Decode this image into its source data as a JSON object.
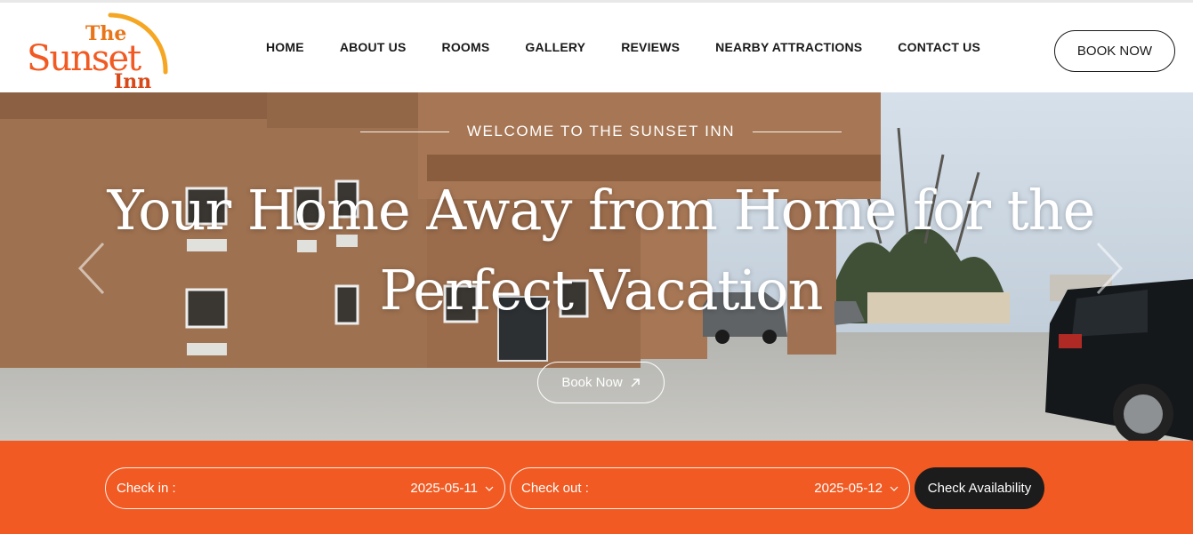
{
  "brand": {
    "line1": "The",
    "line2": "Sunset",
    "line3": "Inn",
    "accent": "#f15a22",
    "gold": "#f5a623"
  },
  "nav": [
    {
      "label": "HOME"
    },
    {
      "label": "ABOUT US"
    },
    {
      "label": "ROOMS"
    },
    {
      "label": "GALLERY"
    },
    {
      "label": "REVIEWS"
    },
    {
      "label": "NEARBY ATTRACTIONS"
    },
    {
      "label": "CONTACT US"
    }
  ],
  "header": {
    "book_label": "BOOK NOW"
  },
  "hero": {
    "welcome": "WELCOME TO THE SUNSET INN",
    "headline_line1": "Your Home Away from Home for the",
    "headline_line2": "Perfect Vacation",
    "book_label": "Book Now",
    "book_icon": "arrow-up-right-icon"
  },
  "booking": {
    "checkin_label": "Check in :",
    "checkin_value": "2025-05-11",
    "checkout_label": "Check out :",
    "checkout_value": "2025-05-12",
    "check_label": "Check Availability",
    "bar_color": "#f15a22"
  }
}
